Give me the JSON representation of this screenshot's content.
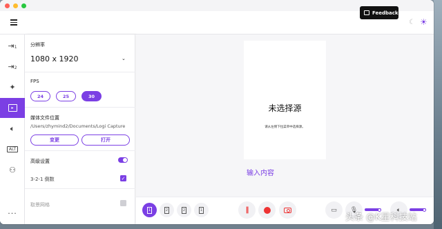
{
  "feedback": {
    "label": "Feedback"
  },
  "sidebar": {
    "resolution_label": "分辨率",
    "resolution_value": "1080 x 1920",
    "fps_label": "FPS",
    "fps_options": [
      "24",
      "25",
      "30"
    ],
    "fps_selected": "30",
    "media_location_label": "媒体文件位置",
    "media_path": "/Users/zhymind2/Documents/Logi Capture",
    "change_button": "变更",
    "open_button": "打开",
    "advanced_label": "高级设置",
    "countdown_label": "3-2-1 倒数",
    "snap_grid_label": "取景网格",
    "advanced_enabled": true,
    "countdown_checked": true,
    "snap_grid_checked": false
  },
  "preview": {
    "title": "未选择源",
    "subtitle": "请从左侧下拉菜单中选择源。"
  },
  "main": {
    "input_content_label": "输入内容"
  },
  "bottombar": {
    "layouts": [
      "1",
      "2",
      "2",
      "1"
    ],
    "mic_level": 0.9,
    "speaker_level": 0.9
  },
  "watermark": "头条 @K星科技站",
  "colors": {
    "accent": "#7b3fe4",
    "record": "#ee3333"
  }
}
